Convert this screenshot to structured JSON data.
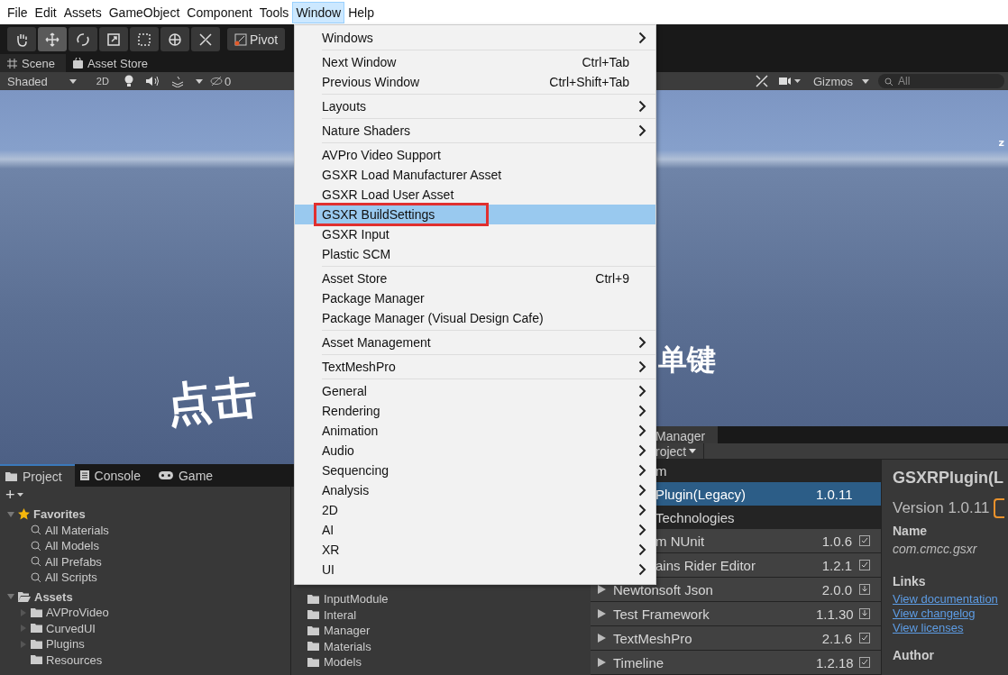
{
  "menubar": [
    {
      "label": "File",
      "selected": false
    },
    {
      "label": "Edit",
      "selected": false
    },
    {
      "label": "Assets",
      "selected": false
    },
    {
      "label": "GameObject",
      "selected": false
    },
    {
      "label": "Component",
      "selected": false
    },
    {
      "label": "Tools",
      "selected": false
    },
    {
      "label": "Window",
      "selected": true
    },
    {
      "label": "Help",
      "selected": false
    }
  ],
  "toolbar": {
    "tools": [
      {
        "kind": "hand",
        "selected": false
      },
      {
        "kind": "move",
        "selected": true
      },
      {
        "kind": "rotate",
        "selected": false
      },
      {
        "kind": "scale",
        "selected": false
      },
      {
        "kind": "rect",
        "selected": false
      },
      {
        "kind": "transform",
        "selected": false
      },
      {
        "kind": "custom",
        "selected": false
      }
    ],
    "pivot": "Pivot"
  },
  "scene_tabs": [
    {
      "label": "Scene",
      "kind": "scene",
      "selected": true
    },
    {
      "label": "Asset Store",
      "kind": "store",
      "selected": false
    }
  ],
  "scene_toolbar": {
    "shading": "Shaded",
    "mode_2d": "2D",
    "hidden_count": "0",
    "gizmos": "Gizmos",
    "search": {
      "placeholder": "All"
    }
  },
  "viewport": {
    "texts": [
      {
        "kind": "left",
        "text": "点击"
      },
      {
        "kind": "right",
        "text": "单键"
      },
      {
        "kind": "axis",
        "text": "z"
      }
    ]
  },
  "menu": {
    "groups": [
      {
        "items": [
          {
            "label": "Windows",
            "submenu": true,
            "selected": false,
            "boxed": false
          }
        ]
      },
      {
        "items": [
          {
            "label": "Next Window",
            "shortcut": "Ctrl+Tab",
            "submenu": false,
            "selected": false,
            "boxed": false
          },
          {
            "label": "Previous Window",
            "shortcut": "Ctrl+Shift+Tab",
            "submenu": false,
            "selected": false,
            "boxed": false
          }
        ]
      },
      {
        "items": [
          {
            "label": "Layouts",
            "submenu": true,
            "selected": false,
            "boxed": false
          }
        ]
      },
      {
        "items": [
          {
            "label": "Nature Shaders",
            "submenu": true,
            "selected": false,
            "boxed": false
          }
        ]
      },
      {
        "items": [
          {
            "label": "AVPro Video Support",
            "submenu": false,
            "selected": false,
            "boxed": false
          },
          {
            "label": "GSXR Load Manufacturer Asset",
            "submenu": false,
            "selected": false,
            "boxed": false
          },
          {
            "label": "GSXR Load User Asset",
            "submenu": false,
            "selected": false,
            "boxed": false
          },
          {
            "label": "GSXR BuildSettings",
            "submenu": false,
            "selected": true,
            "boxed": true
          },
          {
            "label": "GSXR Input",
            "submenu": false,
            "selected": false,
            "boxed": false
          },
          {
            "label": "Plastic SCM",
            "submenu": false,
            "selected": false,
            "boxed": false
          }
        ]
      },
      {
        "items": [
          {
            "label": "Asset Store",
            "shortcut": "Ctrl+9",
            "submenu": false,
            "selected": false,
            "boxed": false
          },
          {
            "label": "Package Manager",
            "submenu": false,
            "selected": false,
            "boxed": false
          },
          {
            "label": "Package Manager (Visual Design Cafe)",
            "submenu": false,
            "selected": false,
            "boxed": false
          }
        ]
      },
      {
        "items": [
          {
            "label": "Asset Management",
            "submenu": true,
            "selected": false,
            "boxed": false
          }
        ]
      },
      {
        "items": [
          {
            "label": "TextMeshPro",
            "submenu": true,
            "selected": false,
            "boxed": false
          }
        ]
      },
      {
        "items": [
          {
            "label": "General",
            "submenu": true,
            "selected": false,
            "boxed": false
          },
          {
            "label": "Rendering",
            "submenu": true,
            "selected": false,
            "boxed": false
          },
          {
            "label": "Animation",
            "submenu": true,
            "selected": false,
            "boxed": false
          },
          {
            "label": "Audio",
            "submenu": true,
            "selected": false,
            "boxed": false
          },
          {
            "label": "Sequencing",
            "submenu": true,
            "selected": false,
            "boxed": false
          },
          {
            "label": "Analysis",
            "submenu": true,
            "selected": false,
            "boxed": false
          },
          {
            "label": "2D",
            "submenu": true,
            "selected": false,
            "boxed": false
          },
          {
            "label": "AI",
            "submenu": true,
            "selected": false,
            "boxed": false
          },
          {
            "label": "XR",
            "submenu": true,
            "selected": false,
            "boxed": false
          },
          {
            "label": "UI",
            "submenu": true,
            "selected": false,
            "boxed": false
          }
        ]
      }
    ]
  },
  "project_panel": {
    "tabs": [
      {
        "label": "Project",
        "kind": "project",
        "selected": true
      },
      {
        "label": "Console",
        "kind": "console",
        "selected": false
      },
      {
        "label": "Game",
        "kind": "game",
        "selected": false
      }
    ],
    "add": "+",
    "tree": [
      {
        "label": "Favorites",
        "kind": "favorites",
        "expanded": true,
        "children": [
          {
            "label": "All Materials",
            "kind": "search"
          },
          {
            "label": "All Models",
            "kind": "search"
          },
          {
            "label": "All Prefabs",
            "kind": "search"
          },
          {
            "label": "All Scripts",
            "kind": "search"
          }
        ]
      },
      {
        "label": "Assets",
        "kind": "assets",
        "expanded": true,
        "children": [
          {
            "label": "AVProVideo",
            "kind": "folder",
            "expanded": false
          },
          {
            "label": "CurvedUI",
            "kind": "folder",
            "expanded": false
          },
          {
            "label": "Plugins",
            "kind": "folder",
            "expanded": false
          },
          {
            "label": "Resources",
            "kind": "folder"
          }
        ]
      }
    ],
    "folders": [
      "InputModule",
      "Interal",
      "Manager",
      "Materials",
      "Models"
    ]
  },
  "package_manager": {
    "tab": "Manager",
    "scope": "roject",
    "rows": [
      {
        "kind": "group",
        "name": "m",
        "partial": true,
        "selected": false
      },
      {
        "kind": "package",
        "name": "Plugin(Legacy)",
        "version": "1.0.11",
        "partial": true,
        "selected": true
      },
      {
        "kind": "group",
        "name": "Technologies",
        "partial": true,
        "selected": false
      },
      {
        "kind": "package",
        "name": "m NUnit",
        "version": "1.0.6",
        "installed": true,
        "partial": true,
        "selected": false
      },
      {
        "kind": "package",
        "name": "ains Rider Editor",
        "version": "1.2.1",
        "installed": true,
        "partial": true,
        "selected": false
      },
      {
        "kind": "package",
        "name": "Newtonsoft Json",
        "version": "2.0.0",
        "installed": false,
        "partial": false,
        "selected": false
      },
      {
        "kind": "package",
        "name": "Test Framework",
        "version": "1.1.30",
        "installed": false,
        "partial": false,
        "selected": false
      },
      {
        "kind": "package",
        "name": "TextMeshPro",
        "version": "2.1.6",
        "installed": true,
        "partial": false,
        "selected": false
      },
      {
        "kind": "package",
        "name": "Timeline",
        "version": "1.2.18",
        "installed": true,
        "partial": false,
        "selected": false
      }
    ],
    "details": {
      "title": "GSXRPlugin(L",
      "version": "Version 1.0.11",
      "name_label": "Name",
      "name": "com.cmcc.gsxr",
      "links_label": "Links",
      "links": [
        "View documentation",
        "View changelog",
        "View licenses"
      ],
      "author_label": "Author"
    }
  }
}
